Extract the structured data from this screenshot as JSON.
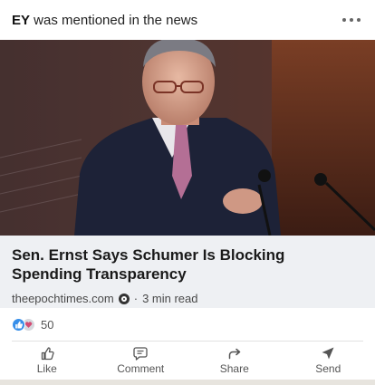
{
  "header": {
    "company": "EY",
    "text": " was mentioned in the news"
  },
  "photo": {
    "alt": "",
    "bg_colors": [
      "#3a2523",
      "#6b3327",
      "#1c1f2b"
    ]
  },
  "article": {
    "title": "Sen. Ernst Says Schumer Is Blocking Spending Transparency",
    "source": "theepochtimes.com",
    "separator": "·",
    "read_time": "3 min read"
  },
  "reactions": {
    "count": "50",
    "types": [
      "like",
      "love"
    ]
  },
  "actions": [
    {
      "label": "Like",
      "icon": "thumbs-up-icon"
    },
    {
      "label": "Comment",
      "icon": "comment-icon"
    },
    {
      "label": "Share",
      "icon": "share-arrow-icon"
    },
    {
      "label": "Send",
      "icon": "send-icon"
    }
  ],
  "colors": {
    "reaction_like": "#378fe9",
    "article_bg": "#eef0f3"
  }
}
